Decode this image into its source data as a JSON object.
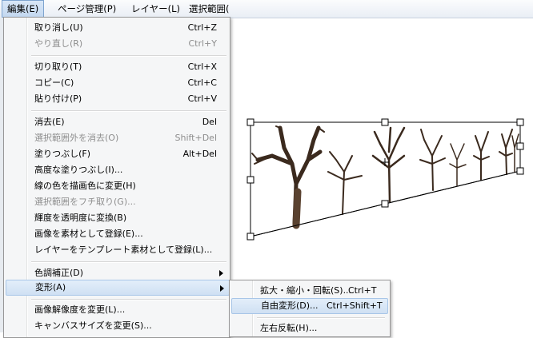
{
  "menubar": {
    "items": [
      {
        "label": "編集(E)"
      },
      {
        "label": "ページ管理(P)"
      },
      {
        "label": "レイヤー(L)"
      },
      {
        "label": "選択範囲("
      }
    ]
  },
  "edit_menu": {
    "items": [
      {
        "label": "取り消し(U)",
        "shortcut": "Ctrl+Z"
      },
      {
        "label": "やり直し(R)",
        "shortcut": "Ctrl+Y"
      },
      {
        "label": "切り取り(T)",
        "shortcut": "Ctrl+X"
      },
      {
        "label": "コピー(C)",
        "shortcut": "Ctrl+C"
      },
      {
        "label": "貼り付け(P)",
        "shortcut": "Ctrl+V"
      },
      {
        "label": "消去(E)",
        "shortcut": "Del"
      },
      {
        "label": "選択範囲外を消去(O)",
        "shortcut": "Shift+Del"
      },
      {
        "label": "塗りつぶし(F)",
        "shortcut": "Alt+Del"
      },
      {
        "label": "高度な塗りつぶし(I)..."
      },
      {
        "label": "線の色を描画色に変更(H)"
      },
      {
        "label": "選択範囲をフチ取り(G)..."
      },
      {
        "label": "輝度を透明度に変換(B)"
      },
      {
        "label": "画像を素材として登録(E)..."
      },
      {
        "label": "レイヤーをテンプレート素材として登録(L)..."
      },
      {
        "label": "色調補正(D)"
      },
      {
        "label": "変形(A)"
      },
      {
        "label": "画像解像度を変更(L)..."
      },
      {
        "label": "キャンバスサイズを変更(S)..."
      }
    ]
  },
  "transform_submenu": {
    "items": [
      {
        "label": "拡大・縮小・回転(S)...",
        "shortcut": "Ctrl+T"
      },
      {
        "label": "自由変形(D)...",
        "shortcut": "Ctrl+Shift+T"
      },
      {
        "label": "左右反転(H)..."
      }
    ]
  }
}
